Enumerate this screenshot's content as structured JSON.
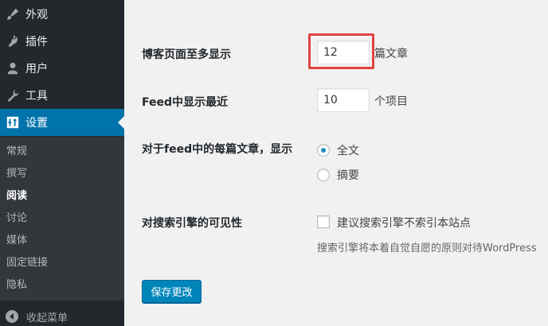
{
  "sidebar": {
    "menu": [
      {
        "label": "外观",
        "icon": "brush-icon"
      },
      {
        "label": "插件",
        "icon": "plugin-icon"
      },
      {
        "label": "用户",
        "icon": "user-icon"
      },
      {
        "label": "工具",
        "icon": "wrench-icon"
      },
      {
        "label": "设置",
        "icon": "settings-icon"
      }
    ],
    "submenu": [
      "常规",
      "撰写",
      "阅读",
      "讨论",
      "媒体",
      "固定链接",
      "隐私"
    ],
    "current_submenu": "阅读",
    "collapse_label": "收起菜单"
  },
  "settings": {
    "posts_per_page": {
      "label": "博客页面至多显示",
      "value": "12",
      "suffix": "篇文章"
    },
    "feed_count": {
      "label": "Feed中显示最近",
      "value": "10",
      "suffix": "个项目"
    },
    "feed_content": {
      "label": "对于feed中的每篇文章，显示",
      "options": [
        "全文",
        "摘要"
      ],
      "selected": "全文"
    },
    "search_visibility": {
      "label": "对搜索引擎的可见性",
      "checkbox_label": "建议搜索引擎不索引本站点",
      "checked": false,
      "description": "搜索引擎将本着自觉自愿的原则对待WordPress"
    }
  },
  "save_button": "保存更改",
  "colors": {
    "admin_bar": "#23282d",
    "accent": "#0073aa",
    "highlight": "#e0443f"
  }
}
